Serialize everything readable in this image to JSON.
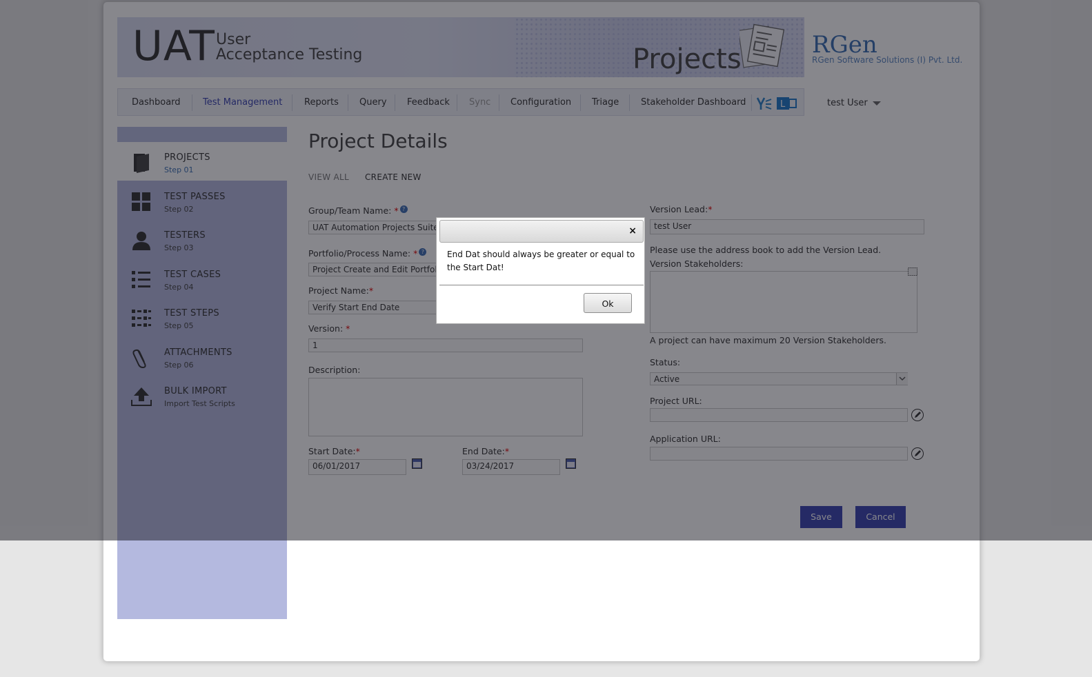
{
  "banner": {
    "logo_main": "UAT",
    "logo_sub_line1": "User",
    "logo_sub_line2": "Acceptance Testing",
    "section_title": "Projects",
    "brand": "RGen",
    "brand_sub": "RGen Software Solutions (I) Pvt. Ltd."
  },
  "nav": {
    "items": [
      "Dashboard",
      "Test Management",
      "Reports",
      "Query",
      "Feedback",
      "Sync",
      "Configuration",
      "Triage",
      "Stakeholder Dashboard"
    ],
    "active_index": 1,
    "disabled_index": 5,
    "user": "test User"
  },
  "sidebar": {
    "items": [
      {
        "label": "PROJECTS",
        "sub": "Step 01",
        "icon": "projects-icon",
        "active": true
      },
      {
        "label": "TEST PASSES",
        "sub": "Step 02",
        "icon": "grid-icon"
      },
      {
        "label": "TESTERS",
        "sub": "Step 03",
        "icon": "user-icon"
      },
      {
        "label": "TEST CASES",
        "sub": "Step 04",
        "icon": "list-icon"
      },
      {
        "label": "TEST STEPS",
        "sub": "Step 05",
        "icon": "steps-icon"
      },
      {
        "label": "ATTACHMENTS",
        "sub": "Step 06",
        "icon": "paperclip-icon"
      },
      {
        "label": "BULK IMPORT",
        "sub": "Import Test Scripts",
        "icon": "upload-icon"
      }
    ]
  },
  "main": {
    "title": "Project Details",
    "tabs": {
      "view_all": "VIEW ALL",
      "create_new": "CREATE NEW"
    },
    "form": {
      "group_label": "Group/Team Name:",
      "group_value": "UAT Automation Projects Suite",
      "portfolio_label": "Portfolio/Process Name:",
      "portfolio_value": "Project Create and Edit Portfolio",
      "project_label": "Project Name:",
      "project_value": "Verify Start End Date",
      "version_label": "Version:",
      "version_value": "1",
      "description_label": "Description:",
      "start_label": "Start Date:",
      "start_value": "06/01/2017",
      "end_label": "End Date:",
      "end_value": "03/24/2017",
      "version_lead_label": "Version Lead:",
      "version_lead_value": "test User",
      "version_lead_note": "Please use the address book to add the Version Lead.",
      "stakeholders_label": "Version Stakeholders:",
      "stakeholders_note": "A project can have maximum 20 Version Stakeholders.",
      "status_label": "Status:",
      "status_value": "Active",
      "project_url_label": "Project URL:",
      "app_url_label": "Application URL:",
      "save": "Save",
      "cancel": "Cancel",
      "required_mark": "*",
      "help_mark": "?"
    }
  },
  "dialog": {
    "message": "End Dat should always be greater or equal to the Start Dat!",
    "close": "×",
    "ok": "Ok"
  },
  "colors": {
    "accent": "#3a44b0",
    "sidebar": "#b4b9df",
    "nav_active": "#3a44b0"
  }
}
